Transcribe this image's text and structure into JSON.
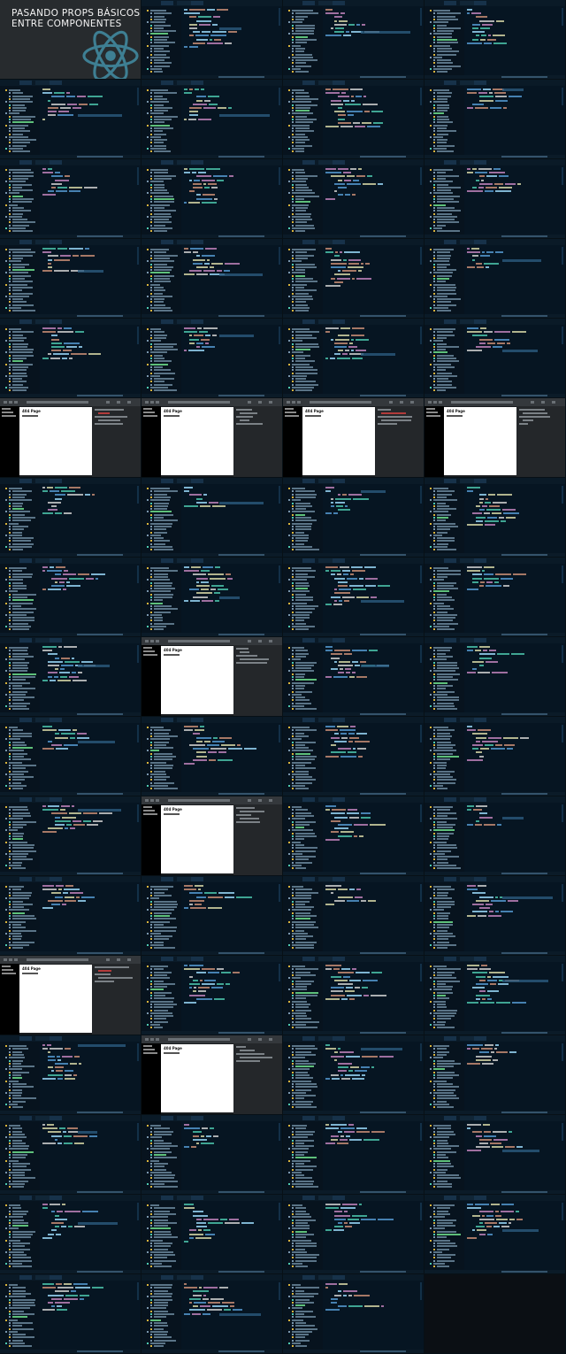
{
  "title_card": {
    "line1": "PASANDO PROPS BÁSICOS",
    "line2": "ENTRE COMPONENTES",
    "logo_icon": "react-logo-icon",
    "background": "#272b2e",
    "logo_color": "#3e7f93"
  },
  "grid": {
    "columns": 4,
    "rows": 17
  },
  "tiles": [
    "title",
    "editor",
    "editor",
    "editor",
    "editor",
    "editor",
    "editor",
    "editor",
    "editor",
    "editor",
    "editor",
    "editor",
    "editor",
    "editor",
    "editor",
    "editor",
    "editor",
    "editor",
    "editor",
    "editor",
    "browser",
    "browser",
    "browser",
    "browser",
    "editor",
    "editor",
    "editor",
    "editor",
    "editor",
    "editor",
    "editor",
    "editor",
    "editor",
    "browser",
    "editor",
    "editor",
    "editor",
    "editor",
    "editor",
    "editor",
    "editor",
    "browser",
    "editor",
    "editor",
    "editor",
    "editor",
    "editor",
    "editor",
    "browser",
    "editor",
    "editor",
    "editor",
    "editor",
    "browser",
    "editor",
    "editor",
    "editor",
    "editor",
    "editor",
    "editor",
    "editor",
    "editor",
    "editor",
    "editor",
    "editor",
    "editor",
    "editor",
    "empty"
  ],
  "browser_page": {
    "heading": "404 Page"
  },
  "colors": {
    "editor_bg": "#061522",
    "syntax_keyword": "#c586c0",
    "syntax_string": "#ce9178",
    "syntax_tag": "#4ec9b0",
    "syntax_plain": "#9cdcfe",
    "folder_icon": "#d8b43c"
  }
}
